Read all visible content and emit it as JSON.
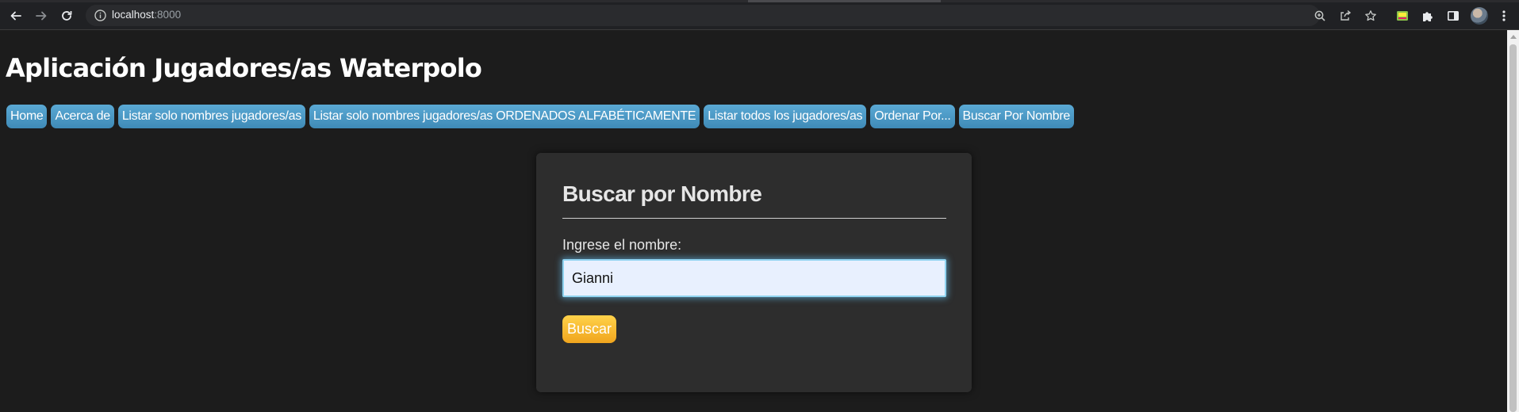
{
  "browser": {
    "url_host": "localhost",
    "url_port": ":8000"
  },
  "app": {
    "title": "Aplicación Jugadores/as Waterpolo"
  },
  "menu": {
    "items": [
      {
        "label": "Home"
      },
      {
        "label": "Acerca de"
      },
      {
        "label": "Listar solo nombres jugadores/as"
      },
      {
        "label": "Listar solo nombres jugadores/as ORDENADOS ALFABÉTICAMENTE"
      },
      {
        "label": "Listar todos los jugadores/as"
      },
      {
        "label": "Ordenar Por..."
      },
      {
        "label": "Buscar Por Nombre"
      }
    ]
  },
  "search_form": {
    "heading": "Buscar por Nombre",
    "label": "Ingrese el nombre:",
    "input_value": "Gianni",
    "submit_label": "Buscar"
  },
  "colors": {
    "page_background": "#1c1c1c",
    "card_background": "#2d2d2d",
    "menu_button": "#4a9ac8",
    "submit_button": "#f7b733",
    "input_focus_glow": "#8fd3f0"
  },
  "icons": {
    "back": "arrow-left",
    "forward": "arrow-right",
    "reload": "reload",
    "site_info": "info-circle",
    "zoom": "magnifier-plus",
    "share": "share-box",
    "bookmark": "star",
    "extension": "colored-extension",
    "extensions_menu": "puzzle-piece",
    "side_panel": "side-panel",
    "profile": "avatar",
    "menu": "vertical-dots"
  }
}
